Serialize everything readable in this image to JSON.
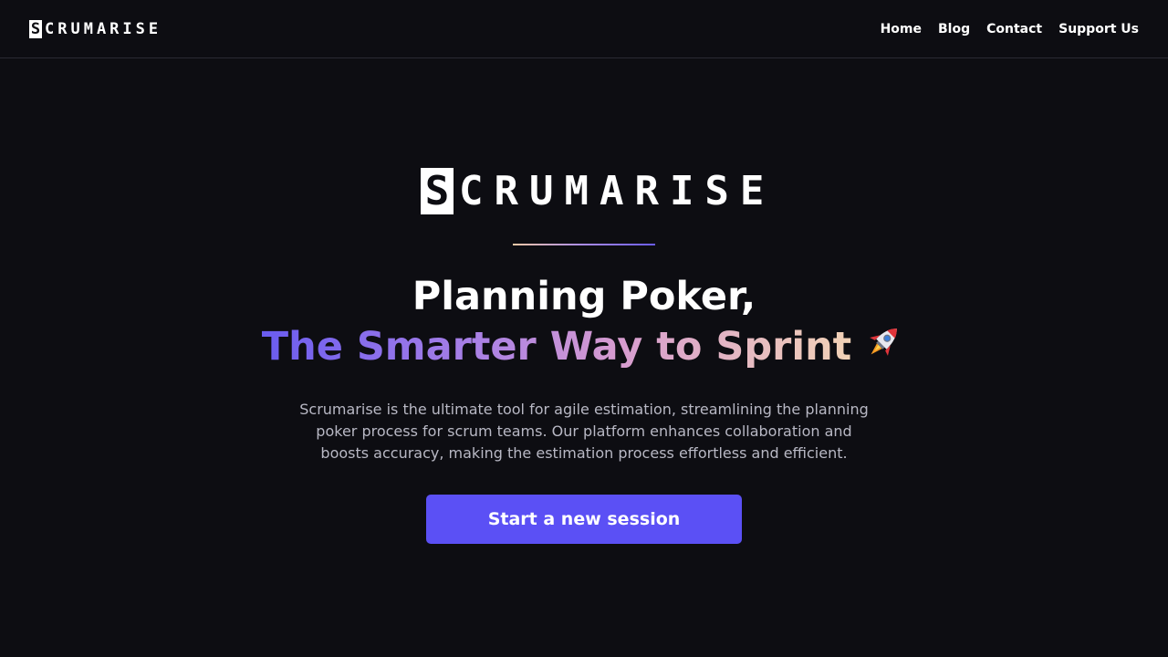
{
  "brand": {
    "logo_initial": "S",
    "logo_rest": "CRUMARISE"
  },
  "nav": {
    "items": [
      {
        "label": "Home"
      },
      {
        "label": "Blog"
      },
      {
        "label": "Contact"
      },
      {
        "label": "Support Us"
      }
    ]
  },
  "hero": {
    "logo_initial": "S",
    "logo_rest": "CRUMARISE",
    "headline_line1": "Planning Poker,",
    "headline_line2": "The Smarter Way to Sprint",
    "rocket_icon": "rocket-icon",
    "description": "Scrumarise is the ultimate tool for agile estimation, streamlining the planning poker process for scrum teams. Our platform enhances collaboration and boosts accuracy, making the estimation process effortless and efficient.",
    "cta_label": "Start a new session"
  },
  "colors": {
    "background": "#0d0d12",
    "accent": "#5b50f5",
    "gradient_start": "#6a5cf0",
    "gradient_end": "#f2d2b6"
  }
}
